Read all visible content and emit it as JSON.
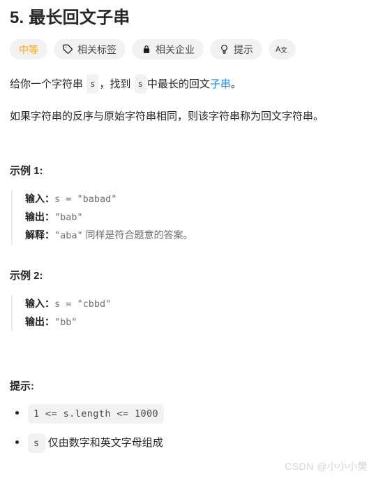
{
  "problem": {
    "title": "5. 最长回文子串",
    "difficulty": "中等"
  },
  "tags": {
    "related_topics": "相关标签",
    "related_companies": "相关企业",
    "hint": "提示",
    "translate_label": "Aa"
  },
  "description": {
    "p1_before": "给你一个字符串",
    "p1_chip1": "s",
    "p1_mid": "，找到",
    "p1_chip2": "s",
    "p1_after": "中最长的回文",
    "p1_link": "子串",
    "p1_end": "。",
    "p2": "如果字符串的反序与原始字符串相同，则该字符串称为回文字符串。"
  },
  "examples": [
    {
      "heading": "示例 1:",
      "input_key": "输入：",
      "input_value": "s = \"babad\"",
      "output_key": "输出：",
      "output_value": "\"bab\"",
      "explain_key": "解释：",
      "explain_value": "\"aba\"",
      "explain_note": " 同样是符合题意的答案。"
    },
    {
      "heading": "示例 2:",
      "input_key": "输入：",
      "input_value": "s = \"cbbd\"",
      "output_key": "输出：",
      "output_value": "\"bb\""
    }
  ],
  "hints": {
    "heading": "提示:",
    "items": [
      {
        "code": "1 <= s.length <= 1000",
        "text": ""
      },
      {
        "code": "s",
        "text": "仅由数字和英文字母组成"
      }
    ]
  },
  "watermark": "CSDN @小小小樊",
  "colors": {
    "difficulty_orange": "#ffa116",
    "link_blue": "#1890ff",
    "pill_bg": "#f2f2f2",
    "text": "#262626",
    "muted": "#6f6f6f",
    "watermark": "#d4d4d4"
  }
}
